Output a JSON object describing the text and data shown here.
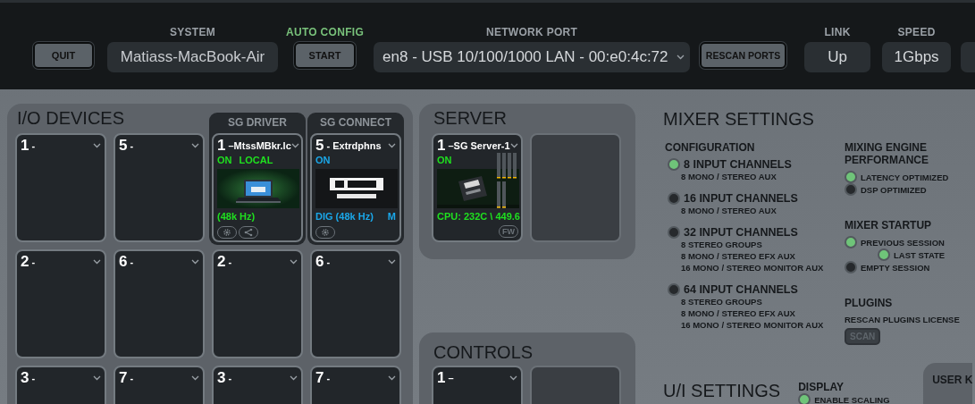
{
  "top_bar": {
    "quit": "QUIT",
    "system": {
      "label": "SYSTEM",
      "value": "Matiass-MacBook-Air"
    },
    "auto_config": {
      "label": "AUTO CONFIG",
      "button": "START"
    },
    "network_port": {
      "label": "NETWORK PORT",
      "value": "en8 - USB 10/100/1000 LAN - 00:e0:4c:72"
    },
    "rescan": "RESCAN PORTS",
    "link": {
      "label": "LINK",
      "value": "Up"
    },
    "speed": {
      "label": "SPEED",
      "value": "1Gbps"
    }
  },
  "io_devices": {
    "title": "I/O DEVICES",
    "columns": [
      {
        "cards": [
          {
            "kind": "slot",
            "number": "1",
            "name": "-"
          },
          {
            "kind": "slot",
            "number": "2",
            "name": "-"
          },
          {
            "kind": "slot",
            "number": "3",
            "name": "-"
          }
        ]
      },
      {
        "cards": [
          {
            "kind": "slot",
            "number": "5",
            "name": "-"
          },
          {
            "kind": "slot",
            "number": "6",
            "name": "-"
          },
          {
            "kind": "slot",
            "number": "7",
            "name": "-"
          }
        ]
      },
      {
        "header": "SG DRIVER",
        "cards": [
          {
            "kind": "driver",
            "number": "1",
            "name": "–MtssMBkr.lc",
            "status": [
              "ON",
              "LOCAL"
            ],
            "rate": "(48k Hz)"
          },
          {
            "kind": "slot",
            "number": "2",
            "name": "-"
          },
          {
            "kind": "slot",
            "number": "3",
            "name": "-"
          }
        ]
      },
      {
        "header": "SG CONNECT",
        "cards": [
          {
            "kind": "connect",
            "number": "5",
            "name": "- Extrdphns",
            "status": [
              "ON"
            ],
            "rate": "DIG (48k Hz)",
            "badge": "M"
          },
          {
            "kind": "slot",
            "number": "6",
            "name": "-"
          },
          {
            "kind": "slot",
            "number": "7",
            "name": "-"
          }
        ]
      }
    ]
  },
  "server": {
    "title": "SERVER",
    "cards": [
      {
        "kind": "server",
        "number": "1",
        "name": "–SG Server-1",
        "status": [
          "ON"
        ],
        "rate": "CPU: 232C \\ 449.6",
        "badge": "FW"
      },
      {
        "kind": "blank"
      }
    ]
  },
  "controls": {
    "title": "CONTROLS",
    "cards": [
      {
        "kind": "slot",
        "number": "1",
        "name": "–"
      },
      {
        "kind": "blank"
      }
    ]
  },
  "mixer_settings": {
    "title": "MIXER SETTINGS",
    "configuration": {
      "title": "CONFIGURATION",
      "options": [
        {
          "label": "8 INPUT CHANNELS",
          "selected": true,
          "details": [
            "8 MONO / STEREO AUX"
          ]
        },
        {
          "label": "16 INPUT CHANNELS",
          "selected": false,
          "details": [
            "8 MONO / STEREO AUX"
          ]
        },
        {
          "label": "32 INPUT CHANNELS",
          "selected": false,
          "details": [
            "8 STEREO GROUPS",
            "8 MONO / STEREO EFX AUX",
            "16 MONO / STEREO MONITOR AUX"
          ]
        },
        {
          "label": "64 INPUT CHANNELS",
          "selected": false,
          "details": [
            "8 STEREO GROUPS",
            "8 MONO / STEREO EFX AUX",
            "16 MONO / STEREO MONITOR AUX"
          ]
        }
      ]
    },
    "performance": {
      "title": "MIXING ENGINE PERFORMANCE",
      "options": [
        {
          "label": "LATENCY OPTIMIZED",
          "selected": true
        },
        {
          "label": "DSP OPTIMIZED",
          "selected": false
        }
      ]
    },
    "startup": {
      "title": "MIXER STARTUP",
      "options": [
        {
          "label": "PREVIOUS SESSION",
          "selected": true,
          "children": [
            {
              "label": "LAST STATE",
              "selected": true
            }
          ]
        },
        {
          "label": "EMPTY SESSION",
          "selected": false
        }
      ]
    },
    "plugins": {
      "title": "PLUGINS",
      "label": "RESCAN PLUGINS LICENSE",
      "button": "SCAN"
    }
  },
  "ui_settings": {
    "title": "U/I SETTINGS",
    "display": {
      "title": "DISPLAY",
      "options": [
        {
          "label": "ENABLE SCALING",
          "selected": true
        }
      ]
    }
  },
  "user_panel": {
    "title": "USER K"
  }
}
